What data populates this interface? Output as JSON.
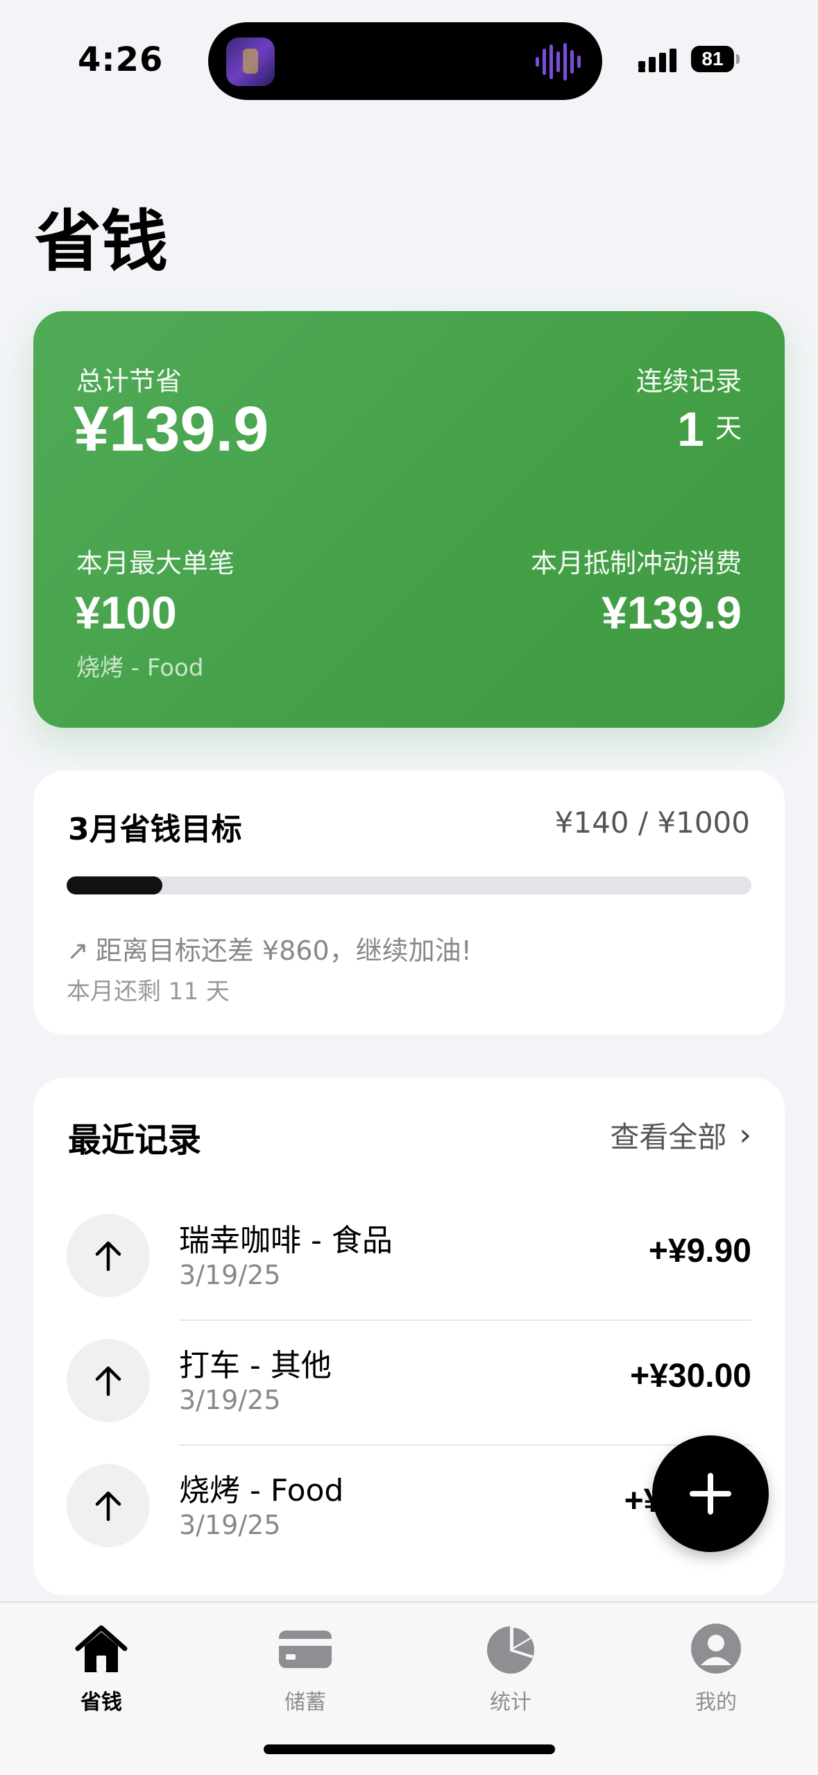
{
  "status_bar": {
    "time": "4:26",
    "battery": "81",
    "icons": [
      "app-thumbnail-icon",
      "audio-wave-icon",
      "signal-icon",
      "battery-icon"
    ]
  },
  "page_title": "省钱",
  "summary": {
    "total_label": "总计节省",
    "total_amount": "¥139.9",
    "streak_label": "连续记录",
    "streak_value": "1",
    "streak_unit": "天",
    "max_label": "本月最大单笔",
    "max_amount": "¥100",
    "max_note": "烧烤 - Food",
    "impulse_label": "本月抵制冲动消费",
    "impulse_amount": "¥139.9",
    "accent_color": "#46A34A"
  },
  "goal": {
    "title": "3月省钱目标",
    "progress_text": "¥140 / ¥1000",
    "progress_fraction": 0.14,
    "hint_icon": "trend-up-arrow-icon",
    "hint": "距离目标还差 ¥860，继续加油!",
    "days_left": "本月还剩 11 天"
  },
  "recent": {
    "title": "最近记录",
    "view_all": "查看全部",
    "items": [
      {
        "icon": "arrow-up-icon",
        "name": "瑞幸咖啡 - 食品",
        "date": "3/19/25",
        "amount": "+¥9.90"
      },
      {
        "icon": "arrow-up-icon",
        "name": "打车 - 其他",
        "date": "3/19/25",
        "amount": "+¥30.00"
      },
      {
        "icon": "arrow-up-icon",
        "name": "烧烤 - Food",
        "date": "3/19/25",
        "amount": "+¥1"
      }
    ]
  },
  "fab_icon": "plus-icon",
  "tabs": [
    {
      "label": "省钱",
      "icon": "house-icon",
      "active": true
    },
    {
      "label": "储蓄",
      "icon": "card-icon",
      "active": false
    },
    {
      "label": "统计",
      "icon": "pie-chart-icon",
      "active": false
    },
    {
      "label": "我的",
      "icon": "person-icon",
      "active": false
    }
  ]
}
